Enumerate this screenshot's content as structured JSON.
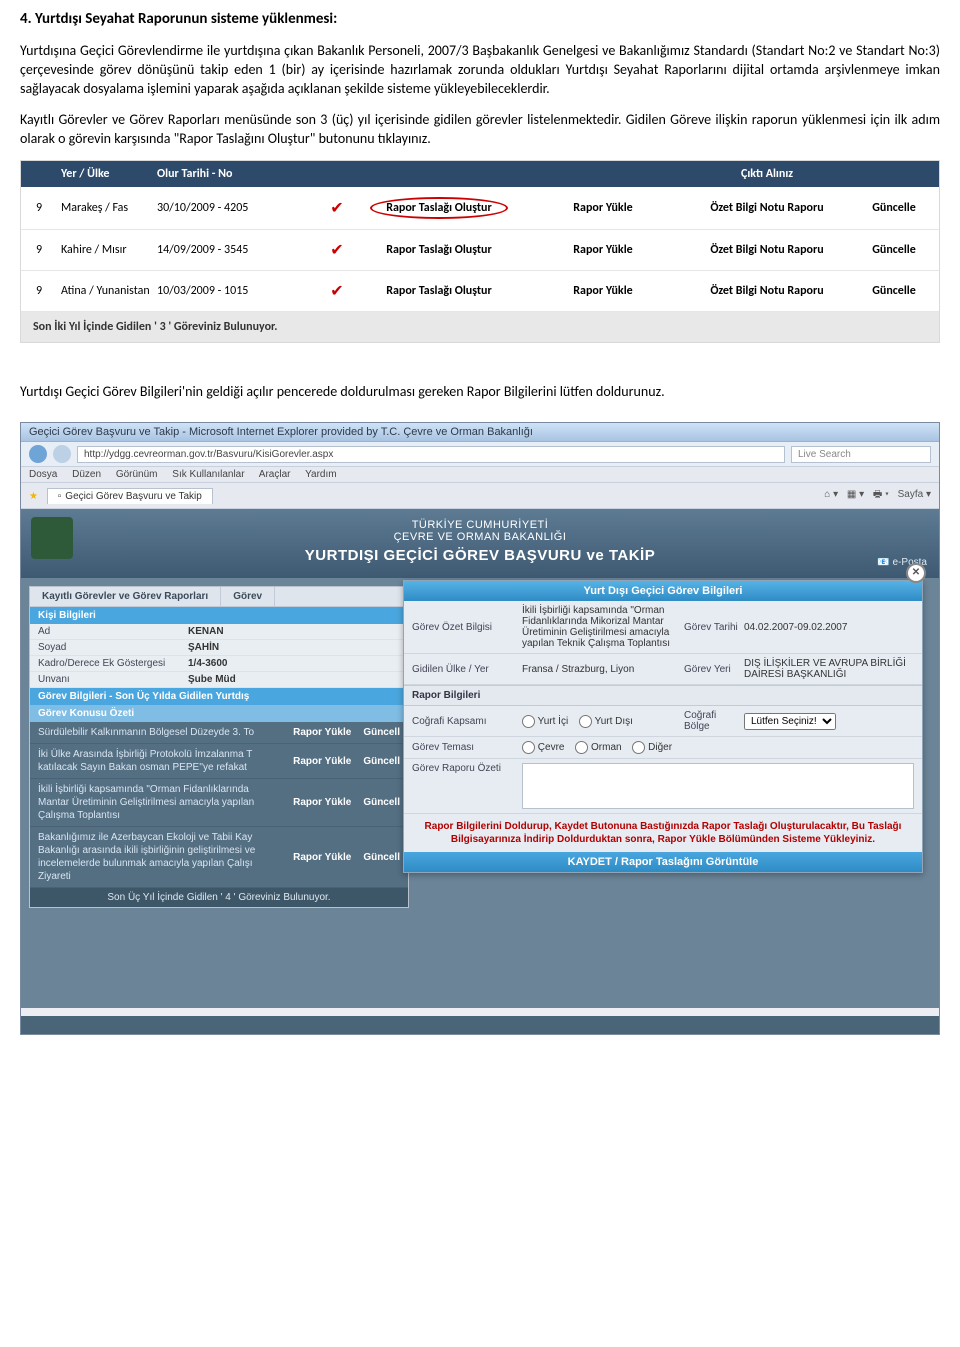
{
  "heading": "4. Yurtdışı Seyahat Raporunun sisteme yüklenmesi:",
  "para1": "Yurtdışına Geçici Görevlendirme ile yurtdışına çıkan Bakanlık Personeli, 2007/3 Başbakanlık Genelgesi ve Bakanlığımız Standardı (Standart No:2 ve Standart No:3) çerçevesinde görev dönüşünü takip eden 1 (bir) ay içerisinde hazırlamak zorunda oldukları Yurtdışı Seyahat Raporlarını dijital ortamda arşivlenmeye imkan sağlayacak dosyalama işlemini yaparak aşağıda açıklanan şekilde sisteme yükleyebileceklerdir.",
  "para2": "Kayıtlı Görevler ve Görev Raporları menüsünde son 3 (üç) yıl içerisinde gidilen görevler listelenmektedir. Gidilen Göreve ilişkin raporun yüklenmesi için ilk adım olarak o görevin karşısında \"Rapor Taslağını Oluştur\" butonunu tıklayınız.",
  "shot1": {
    "headers": {
      "yer": "Yer / Ülke",
      "tarih": "Olur Tarihi - No",
      "cikti": "Çıktı Alınız"
    },
    "rows": [
      {
        "n": "9",
        "place": "Marakeş / Fas",
        "date": "30/10/2009 - 4205",
        "rapor_taslagi": "Rapor Taslağı Oluştur",
        "rapor_yukle": "Rapor Yükle",
        "ozet": "Özet Bilgi Notu Raporu",
        "guncelle": "Güncelle",
        "highlight": true
      },
      {
        "n": "9",
        "place": "Kahire / Mısır",
        "date": "14/09/2009 - 3545",
        "rapor_taslagi": "Rapor Taslağı Oluştur",
        "rapor_yukle": "Rapor Yükle",
        "ozet": "Özet Bilgi Notu Raporu",
        "guncelle": "Güncelle",
        "highlight": false
      },
      {
        "n": "9",
        "place": "Atina / Yunanistan",
        "date": "10/03/2009 - 1015",
        "rapor_taslagi": "Rapor Taslağı Oluştur",
        "rapor_yukle": "Rapor Yükle",
        "ozet": "Özet Bilgi Notu Raporu",
        "guncelle": "Güncelle",
        "highlight": false
      }
    ],
    "footer": "Son İki Yıl İçinde Gidilen ' 3 ' Göreviniz Bulunuyor."
  },
  "mid_para": "Yurtdışı Geçici Görev Bilgileri'nin geldiği açılır pencerede doldurulması gereken Rapor Bilgilerini lütfen doldurunuz.",
  "browser": {
    "title": "Geçici Görev Başvuru ve Takip - Microsoft Internet Explorer provided by T.C. Çevre ve Orman Bakanlığı",
    "url": "http://ydgg.cevreorman.gov.tr/Basvuru/KisiGorevler.aspx",
    "search_placeholder": "Live Search",
    "menu": [
      "Dosya",
      "Düzen",
      "Görünüm",
      "Sık Kullanılanlar",
      "Araçlar",
      "Yardım"
    ],
    "tab_label": "Geçici Görev Başvuru ve Takip",
    "toolbar_right": "Sayfa ▾",
    "banner_tc": "TÜRKİYE CUMHURİYETİ",
    "banner_bak": "ÇEVRE VE ORMAN BAKANLIĞI",
    "banner_main": "YURTDIŞI GEÇİCİ GÖREV BAŞVURU ve TAKİP",
    "eposta": "e-Posta"
  },
  "left": {
    "tabs": [
      "Kayıtlı Görevler ve Görev Raporları",
      "Görev"
    ],
    "kisi_h": "Kişi Bilgileri",
    "kisi": [
      {
        "k": "Ad",
        "v": "KENAN"
      },
      {
        "k": "Soyad",
        "v": "ŞAHİN"
      },
      {
        "k": "Kadro/Derece Ek Göstergesi",
        "v": "1/4-3600"
      },
      {
        "k": "Unvanı",
        "v": "Şube Müd"
      }
    ],
    "gorev_h": "Görev Bilgileri - Son Üç Yılda Gidilen Yurtdış",
    "konu_h": "Görev Konusu Özeti",
    "projects": [
      "Sürdülebilir Kalkınmanın Bölgesel Düzeyde 3. To",
      "İki Ülke Arasında İşbirliği Protokolü İmzalanma T katılacak Sayın Bakan osman PEPE''ye refakat",
      "İkili İşbirliği kapsamında \"Orman Fidanlıklarında Mantar Üretiminin Geliştirilmesi amacıyla yapılan Çalışma Toplantısı",
      "Bakanlığımız ile Azerbaycan Ekoloji ve Tabii Kay Bakanlığı arasında ikili işbirliğinin geliştirilmesi ve incelemelerde bulunmak amacıyla yapılan Çalışı Ziyareti"
    ],
    "rapor_yukle": "Rapor Yükle",
    "guncelle": "Güncell",
    "count": "Son Üç Yıl İçinde Gidilen ' 4 ' Göreviniz Bulunuyor."
  },
  "modal": {
    "title": "Yurt Dışı Geçici Görev Bilgileri",
    "ozet_k": "Görev Özet Bilgisi",
    "ozet_v": "İkili İşbirliği kapsamında \"Orman Fidanlıklarında Mikorizal Mantar Üretiminin Geliştirilmesi amacıyla yapılan Teknik Çalışma Toplantısı",
    "tarih_k": "Görev Tarihi",
    "tarih_v": "04.02.2007-09.02.2007",
    "ulke_k": "Gidilen Ülke / Yer",
    "ulke_v": "Fransa / Strazburg, Liyon",
    "yeri_k": "Görev Yeri",
    "yeri_v": "DIŞ İLİŞKİLER VE AVRUPA BİRLİĞİ DAİRESİ BAŞKANLIĞI",
    "rapor_h": "Rapor Bilgileri",
    "kapsam_k": "Coğrafi Kapsamı",
    "kapsam_opts": [
      "Yurt İçi",
      "Yurt Dışı"
    ],
    "bolge_k": "Coğrafi Bölge",
    "bolge_sel": "Lütfen Seçiniz!",
    "tema_k": "Görev Teması",
    "tema_opts": [
      "Çevre",
      "Orman",
      "Diğer"
    ],
    "raporozet_k": "Görev Raporu Özeti",
    "warn": "Rapor Bilgilerini Doldurup, Kaydet Butonuna Bastığınızda Rapor Taslağı Oluşturulacaktır, Bu Taslağı Bilgisayarınıza İndirip Doldurduktan sonra, Rapor Yükle Bölümünden Sisteme Yükleyiniz.",
    "save": "KAYDET  / Rapor Taslağını Görüntüle"
  }
}
